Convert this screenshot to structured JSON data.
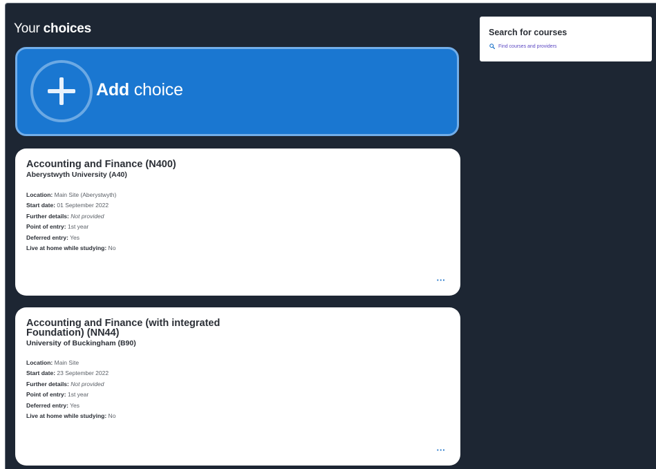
{
  "heading": {
    "prefix": "Your ",
    "bold": "choices"
  },
  "add_choice": {
    "bold": "Add",
    "rest": " choice"
  },
  "choices": [
    {
      "title": "Accounting and Finance (N400)",
      "provider": "Aberystwyth University (A40)",
      "details": [
        {
          "label": "Location:",
          "value": " Main Site (Aberystwyth)"
        },
        {
          "label": "Start date:",
          "value": " 01 September 2022"
        },
        {
          "label": "Further details:",
          "value": " Not provided"
        },
        {
          "label": "Point of entry:",
          "value": " 1st year"
        },
        {
          "label": "Deferred entry:",
          "value": " Yes"
        },
        {
          "label": "Live at home while studying:",
          "value": " No"
        }
      ],
      "more_label": "···"
    },
    {
      "title": "Accounting and Finance (with integrated Foundation) (NN44)",
      "provider": "University of Buckingham (B90)",
      "details": [
        {
          "label": "Location:",
          "value": " Main Site"
        },
        {
          "label": "Start date:",
          "value": " 23 September 2022"
        },
        {
          "label": "Further details:",
          "value": " Not provided"
        },
        {
          "label": "Point of entry:",
          "value": " 1st year"
        },
        {
          "label": "Deferred entry:",
          "value": " Yes"
        },
        {
          "label": "Live at home while studying:",
          "value": " No"
        }
      ],
      "more_label": "···"
    }
  ],
  "search": {
    "title": "Search for courses",
    "link": "Find courses and providers",
    "icon": "search-icon"
  },
  "colors": {
    "background": "#1d2633",
    "add_choice_fill": "#1a77d1",
    "link": "#5b47c2",
    "more": "#1f74c9"
  }
}
